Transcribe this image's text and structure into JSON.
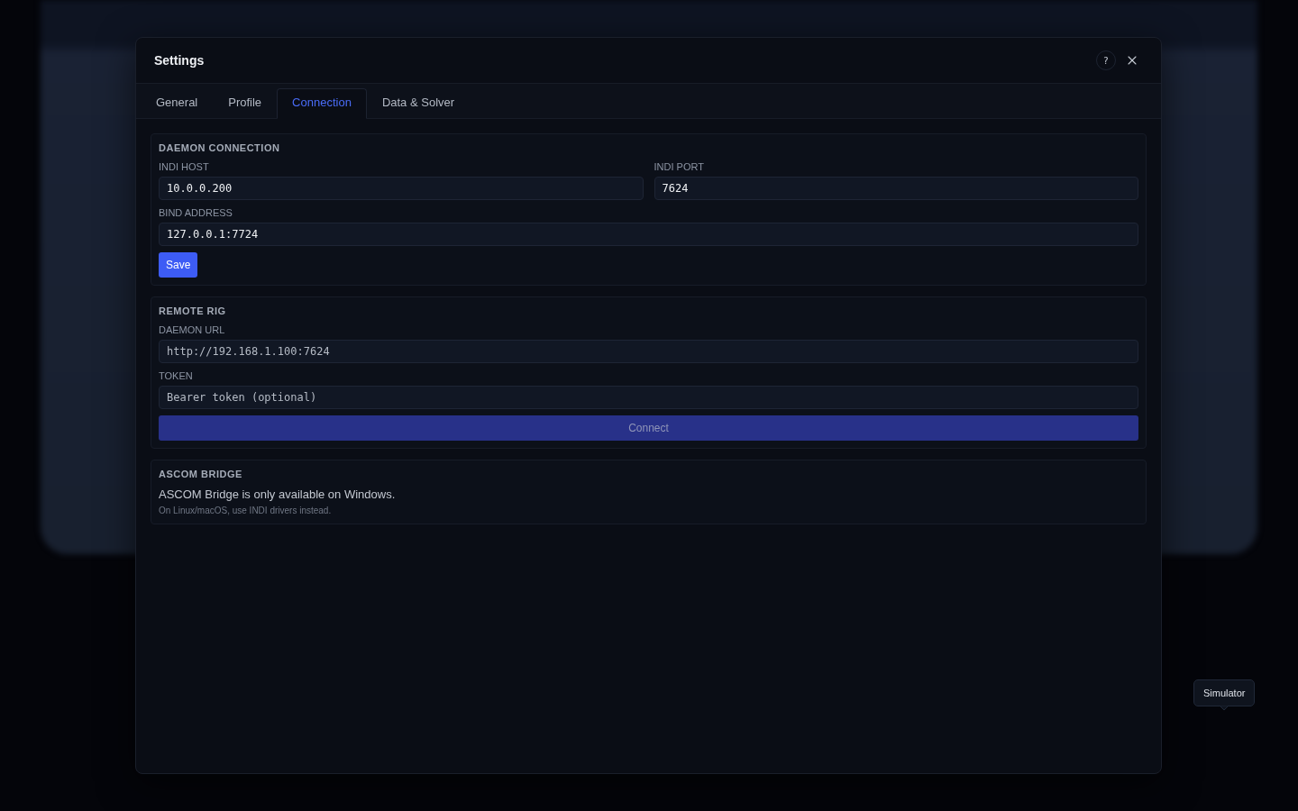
{
  "dialog": {
    "title": "Settings",
    "help_button": "?"
  },
  "tabs": [
    {
      "label": "General",
      "selected": false
    },
    {
      "label": "Profile",
      "selected": false
    },
    {
      "label": "Connection",
      "selected": true
    },
    {
      "label": "Data & Solver",
      "selected": false
    }
  ],
  "sections": [
    {
      "kind": "form",
      "title": "DAEMON CONNECTION",
      "rows": [
        [
          {
            "label": "INDI HOST",
            "value": "10.0.0.200"
          },
          {
            "label": "INDI PORT",
            "value": "7624"
          }
        ],
        [
          {
            "label": "BIND ADDRESS",
            "value": "127.0.0.1:7724"
          }
        ]
      ],
      "button": {
        "label": "Save",
        "kind": "inline",
        "disabled": false
      }
    },
    {
      "kind": "form",
      "title": "REMOTE RIG",
      "rows": [
        [
          {
            "label": "DAEMON URL",
            "placeholder": "http://192.168.1.100:7624"
          }
        ],
        [
          {
            "label": "TOKEN",
            "placeholder": "Bearer token (optional)"
          }
        ]
      ],
      "button": {
        "label": "Connect",
        "kind": "block",
        "disabled": true
      }
    },
    {
      "kind": "notice",
      "title": "ASCOM BRIDGE",
      "message": "ASCOM Bridge is only available on Windows.",
      "note": "On Linux/macOS, use INDI drivers instead."
    }
  ],
  "tooltip": {
    "text": "Simulator"
  }
}
